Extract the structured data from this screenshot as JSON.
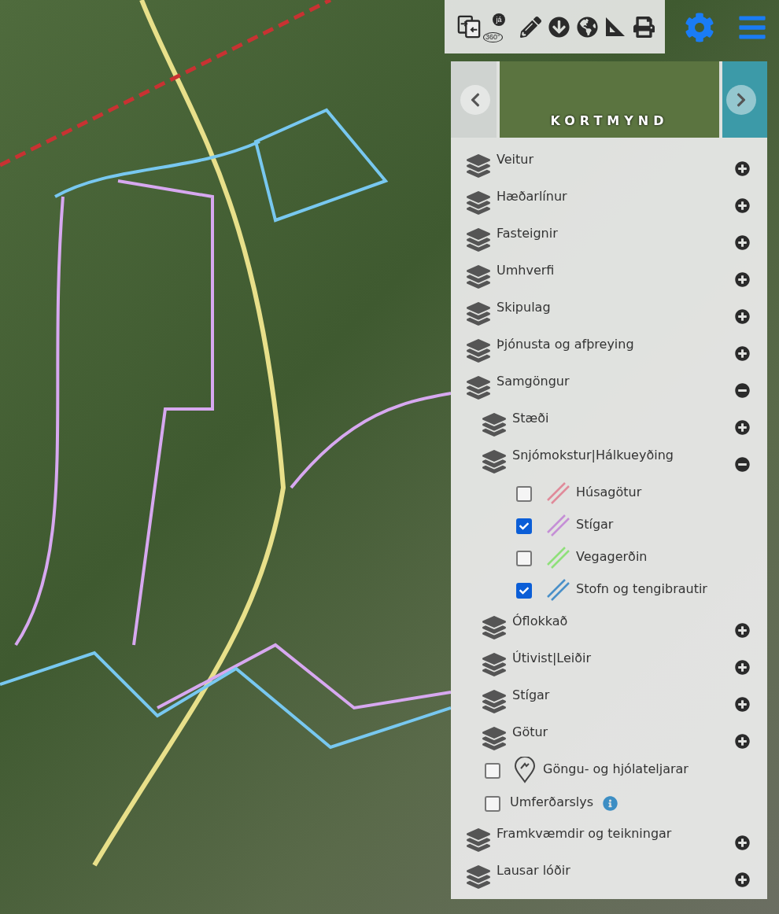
{
  "toolbar": {
    "buttons": [
      {
        "kind": "compare"
      },
      {
        "kind": "street-view",
        "badge": "já",
        "caption": "360°"
      },
      {
        "kind": "draw"
      },
      {
        "kind": "download"
      },
      {
        "kind": "globe"
      },
      {
        "kind": "measure"
      },
      {
        "kind": "print"
      }
    ]
  },
  "basemap_carousel": {
    "label": "KORTMYND"
  },
  "layers": [
    {
      "kind": "group",
      "label": "Veitur",
      "expanded": false
    },
    {
      "kind": "group",
      "label": "Hæðarlínur",
      "expanded": false
    },
    {
      "kind": "group",
      "label": "Fasteignir",
      "expanded": false
    },
    {
      "kind": "group",
      "label": "Umhverfi",
      "expanded": false
    },
    {
      "kind": "group",
      "label": "Skipulag",
      "expanded": false
    },
    {
      "kind": "group",
      "label": "Þjónusta og afþreying",
      "expanded": false
    },
    {
      "kind": "group",
      "label": "Samgöngur",
      "expanded": true,
      "children": [
        {
          "kind": "group",
          "label": "Stæði",
          "expanded": false
        },
        {
          "kind": "group",
          "label": "Snjómokstur|Hálkueyðing",
          "expanded": true,
          "children": [
            {
              "kind": "line",
              "label": "Húsagötur",
              "checked": false,
              "color": "#e08a9a"
            },
            {
              "kind": "line",
              "label": "Stígar",
              "checked": true,
              "color": "#c58fd6"
            },
            {
              "kind": "line",
              "label": "Vegagerðin",
              "checked": false,
              "color": "#8fe07a"
            },
            {
              "kind": "line",
              "label": "Stofn og tengibrautir",
              "checked": true,
              "color": "#4a90c8"
            }
          ]
        },
        {
          "kind": "group",
          "label": "Óflokkað",
          "expanded": false
        },
        {
          "kind": "group",
          "label": "Útivist|Leiðir",
          "expanded": false
        },
        {
          "kind": "group",
          "label": "Stígar",
          "expanded": false
        },
        {
          "kind": "group",
          "label": "Götur",
          "expanded": false
        },
        {
          "kind": "marker",
          "label": "Göngu- og hjólateljarar",
          "checked": false
        },
        {
          "kind": "info",
          "label": "Umferðarslys",
          "checked": false
        }
      ]
    },
    {
      "kind": "group",
      "label": "Framkvæmdir og teikningar",
      "expanded": false
    },
    {
      "kind": "group",
      "label": "Lausar lóðir",
      "expanded": false
    }
  ]
}
